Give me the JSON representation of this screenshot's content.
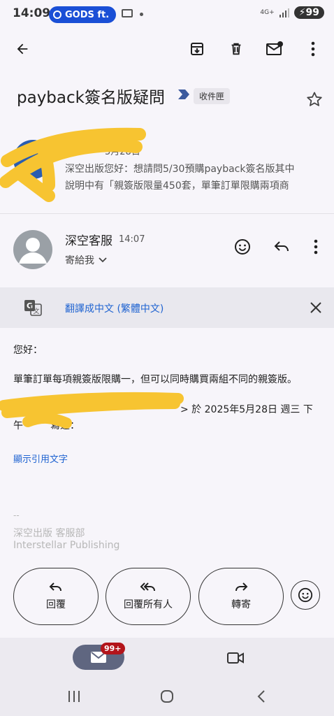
{
  "status_bar": {
    "time": "14:09",
    "app_pill": "GODS ft.",
    "network": "4G+",
    "battery": "99"
  },
  "email": {
    "subject": "payback簽名版疑問",
    "label": "收件匣",
    "earlier_message": {
      "date_fragment": "5月28日",
      "preview_line1": "深空出版您好：想請問5/30預購payback簽名版其中",
      "preview_line2": "說明中有「親簽版限量450套，單筆訂單限購兩項商"
    },
    "sender": {
      "name": "深空客服",
      "time": "14:07",
      "recipient": "寄給我"
    },
    "translate": {
      "link_text": "翻譯成中文 (繁體中文)"
    },
    "body": {
      "greeting": "您好：",
      "line1": "單筆訂單每項親簽版限購一，但可以同時購買兩組不同的親簽版。",
      "quote_header_visible": "> 於 2025年5月28日 週三 下",
      "quote_header_line2_start": "午",
      "quote_header_line2_end": "寫道：",
      "show_quoted": "顯示引用文字"
    },
    "signature": {
      "dashes": "--",
      "line1": "深空出版 客服部",
      "line2": "Interstellar Publishing"
    }
  },
  "actions": {
    "reply": "回覆",
    "reply_all": "回覆所有人",
    "forward": "轉寄"
  },
  "bottom_nav": {
    "mail_badge": "99+"
  },
  "icons": [
    "back-arrow-icon",
    "archive-icon",
    "delete-icon",
    "mark-unread-icon",
    "more-vert-icon",
    "star-icon",
    "important-marker-icon",
    "emoji-icon",
    "reply-icon",
    "translate-icon",
    "close-icon",
    "mail-icon",
    "video-icon"
  ],
  "colors": {
    "accent_blue": "#1f63d1",
    "status_pill": "#1a4fd6",
    "badge_red": "#b3141a",
    "scribble_yellow": "#f7c431"
  }
}
